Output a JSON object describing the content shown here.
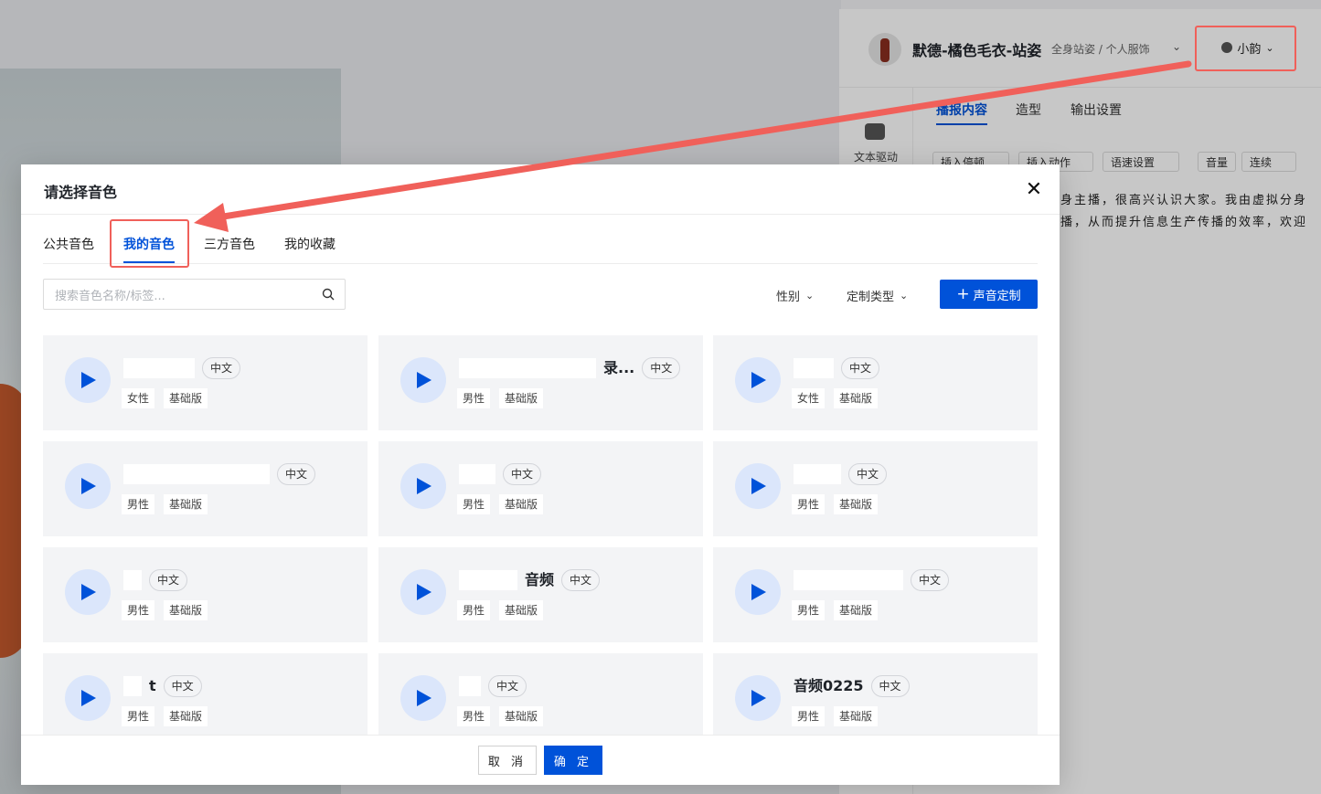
{
  "app": {
    "title": "默德-橘色毛衣-站姿",
    "subtitle": "全身站姿 / 个人服饰",
    "voice_label": "小韵",
    "side_label": "文本驱动",
    "tabs": [
      "播报内容",
      "造型",
      "输出设置"
    ],
    "tools": [
      "插入停顿",
      "插入动作",
      "语速设置",
      "音量",
      "连续"
    ],
    "script_lines": [
      "身主播，很高兴认识大家。我由虚拟分身",
      "播，从而提升信息生产传播的效率，欢迎"
    ]
  },
  "dialog": {
    "title": "请选择音色",
    "tabs": [
      "公共音色",
      "我的音色",
      "三方音色",
      "我的收藏"
    ],
    "active_tab": "我的音色",
    "search_placeholder": "搜索音色名称/标签...",
    "filters": {
      "gender": "性别",
      "type": "定制类型"
    },
    "custom_button": "声音定制",
    "cancel": "取 消",
    "ok": "确 定"
  },
  "voices": [
    {
      "name": "",
      "lang": "中文",
      "gender": "女性",
      "level": "基础版"
    },
    {
      "name": "录...",
      "lang": "中文",
      "gender": "男性",
      "level": "基础版"
    },
    {
      "name": "",
      "lang": "中文",
      "gender": "女性",
      "level": "基础版"
    },
    {
      "name": "",
      "lang": "中文",
      "gender": "男性",
      "level": "基础版"
    },
    {
      "name": "",
      "lang": "中文",
      "gender": "男性",
      "level": "基础版"
    },
    {
      "name": "",
      "lang": "中文",
      "gender": "男性",
      "level": "基础版"
    },
    {
      "name": "",
      "lang": "中文",
      "gender": "男性",
      "level": "基础版"
    },
    {
      "name": "音频",
      "lang": "中文",
      "gender": "男性",
      "level": "基础版"
    },
    {
      "name": "",
      "lang": "中文",
      "gender": "男性",
      "level": "基础版"
    },
    {
      "name": "t",
      "lang": "中文",
      "gender": "男性",
      "level": "基础版"
    },
    {
      "name": "",
      "lang": "中文",
      "gender": "男性",
      "level": "基础版"
    },
    {
      "name": "音频0225",
      "lang": "中文",
      "gender": "男性",
      "level": "基础版"
    }
  ],
  "colors": {
    "accent": "#0052d9",
    "annotation": "#f0605a"
  }
}
